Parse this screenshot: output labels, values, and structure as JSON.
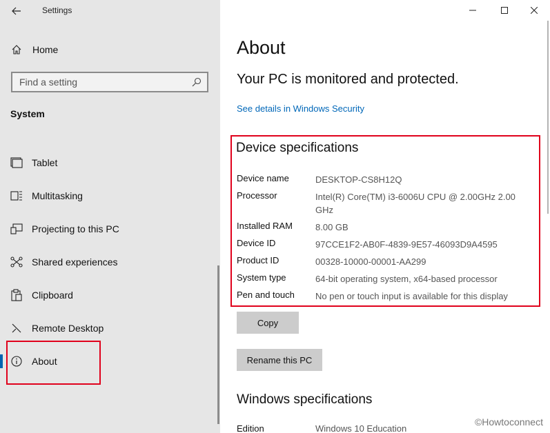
{
  "window": {
    "app_title": "Settings",
    "controls": [
      "minimize",
      "maximize",
      "close"
    ]
  },
  "sidebar": {
    "home_label": "Home",
    "search": {
      "placeholder": "Find a setting"
    },
    "section_title": "System",
    "items": [
      {
        "label": "Tablet",
        "icon": "tablet-icon"
      },
      {
        "label": "Multitasking",
        "icon": "multitasking-icon"
      },
      {
        "label": "Projecting to this PC",
        "icon": "projecting-icon"
      },
      {
        "label": "Shared experiences",
        "icon": "shared-experiences-icon"
      },
      {
        "label": "Clipboard",
        "icon": "clipboard-icon"
      },
      {
        "label": "Remote Desktop",
        "icon": "remote-desktop-icon"
      },
      {
        "label": "About",
        "icon": "info-icon",
        "active": true
      }
    ]
  },
  "main": {
    "title": "About",
    "protection_status": "Your PC is monitored and protected.",
    "security_link": "See details in Windows Security",
    "device_specs": {
      "title": "Device specifications",
      "rows": [
        {
          "key": "Device name",
          "value": "DESKTOP-CS8H12Q"
        },
        {
          "key": "Processor",
          "value": "Intel(R) Core(TM) i3-6006U CPU @ 2.00GHz   2.00 GHz"
        },
        {
          "key": "Installed RAM",
          "value": "8.00 GB"
        },
        {
          "key": "Device ID",
          "value": "97CCE1F2-AB0F-4839-9E57-46093D9A4595"
        },
        {
          "key": "Product ID",
          "value": "00328-10000-00001-AA299"
        },
        {
          "key": "System type",
          "value": "64-bit operating system, x64-based processor"
        },
        {
          "key": "Pen and touch",
          "value": "No pen or touch input is available for this display"
        }
      ]
    },
    "copy_button": "Copy",
    "rename_button": "Rename this PC",
    "windows_specs": {
      "title": "Windows specifications",
      "edition_key": "Edition",
      "edition_value": "Windows 10 Education"
    }
  },
  "watermark": "©Howtoconnect",
  "colors": {
    "sidebar_bg": "#e6e6e6",
    "accent": "#0063b1",
    "link": "#0067b8",
    "highlight": "#e0001b",
    "button_bg": "#cccccc"
  }
}
